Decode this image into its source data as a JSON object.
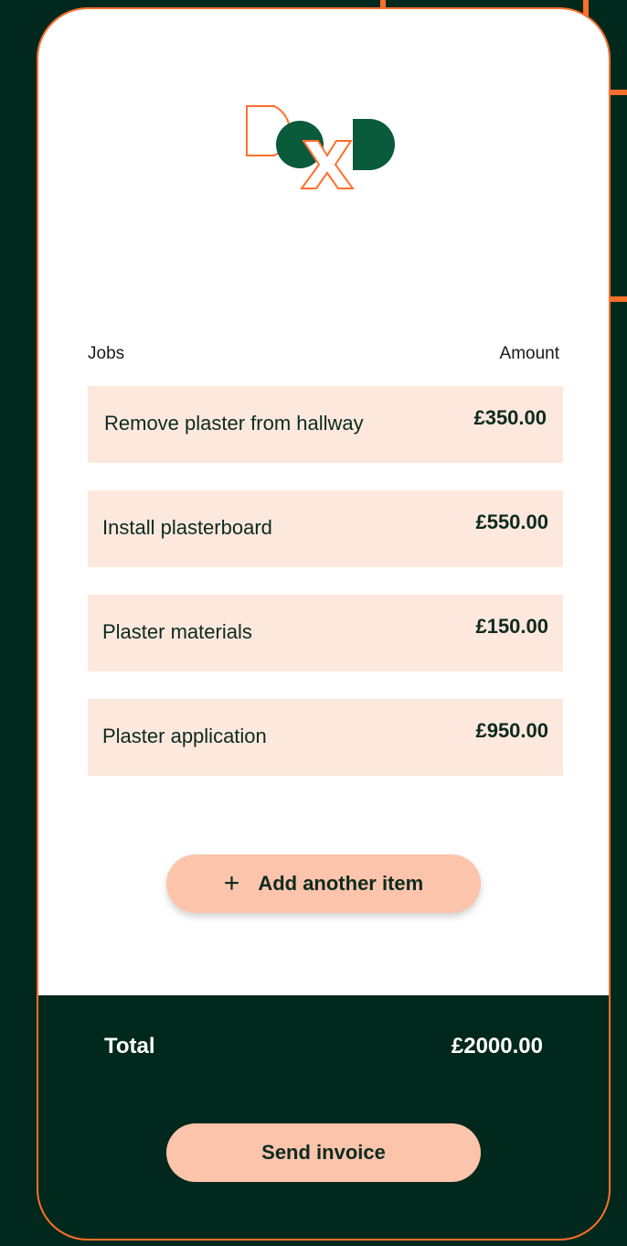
{
  "brand": {
    "logo_letters": "DxD",
    "colors": {
      "accent": "#ff6f2c",
      "dark": "#00281c",
      "green": "#0a5a3c",
      "peach": "#fbc4ab",
      "row": "#fde8dd"
    }
  },
  "invoice": {
    "jobs_header": "Jobs",
    "amount_header": "Amount",
    "items": [
      {
        "name": "Remove plaster from hallway",
        "amount": "£350.00"
      },
      {
        "name": "Install plasterboard",
        "amount": "£550.00"
      },
      {
        "name": "Plaster materials",
        "amount": "£150.00"
      },
      {
        "name": "Plaster application",
        "amount": "£950.00"
      }
    ],
    "add_item_label": "Add another item",
    "add_item_icon": "plus-icon",
    "total_label": "Total",
    "total_value": "£2000.00",
    "send_label": "Send invoice"
  }
}
